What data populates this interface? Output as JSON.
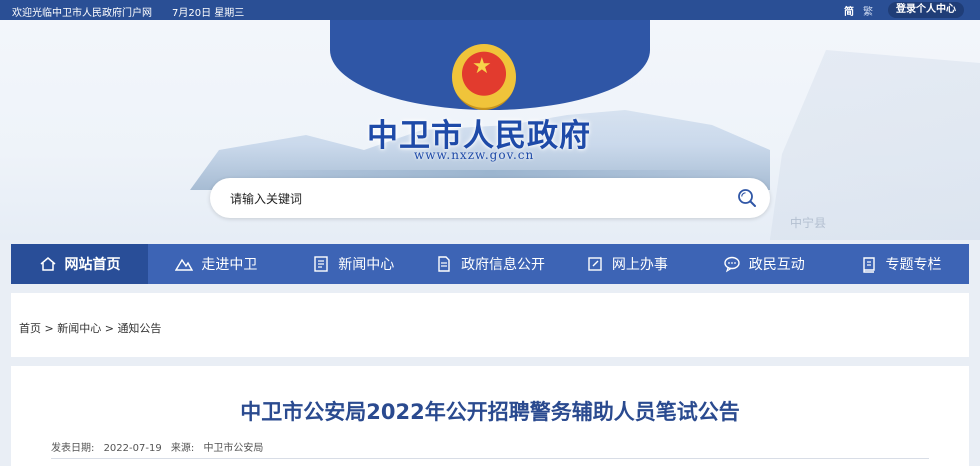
{
  "topbar": {
    "welcome": "欢迎光临中卫市人民政府门户网",
    "date": "7月20日 星期三",
    "lang_simplified": "简",
    "lang_traditional": "繁",
    "login": "登录个人中心"
  },
  "header": {
    "site_title": "中卫市人民政府",
    "site_url": "www.nxzw.gov.cn",
    "map_label": "中宁县"
  },
  "search": {
    "placeholder": "请输入关键词",
    "icon": "search-icon"
  },
  "nav": {
    "items": [
      {
        "label": "网站首页",
        "icon": "home-icon"
      },
      {
        "label": "走进中卫",
        "icon": "mountain-icon"
      },
      {
        "label": "新闻中心",
        "icon": "news-icon"
      },
      {
        "label": "政府信息公开",
        "icon": "document-icon"
      },
      {
        "label": "网上办事",
        "icon": "edit-icon"
      },
      {
        "label": "政民互动",
        "icon": "chat-icon"
      },
      {
        "label": "专题专栏",
        "icon": "book-icon"
      }
    ]
  },
  "breadcrumb": {
    "items": [
      "首页",
      "新闻中心",
      "通知公告"
    ],
    "separator": ">"
  },
  "article": {
    "title": "中卫市公安局2022年公开招聘警务辅助人员笔试公告",
    "date_label": "发表日期:",
    "date": "2022-07-19",
    "source_label": "来源:",
    "source": "中卫市公安局"
  },
  "colors": {
    "primary": "#3d64b5",
    "primary_dark": "#294e98",
    "topbar": "#2a4f95",
    "title": "#2a4a8f"
  }
}
